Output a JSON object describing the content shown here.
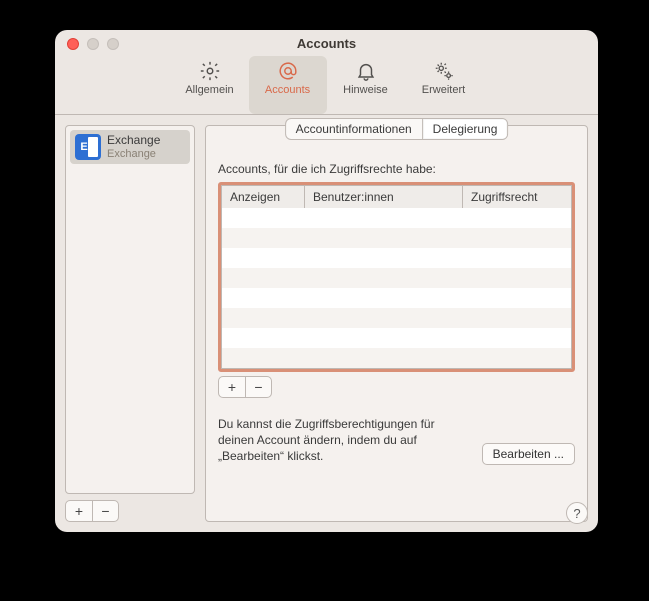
{
  "window": {
    "title": "Accounts"
  },
  "toolbar": {
    "general": "Allgemein",
    "accounts": "Accounts",
    "notifications": "Hinweise",
    "advanced": "Erweitert"
  },
  "sidebar": {
    "accounts": [
      {
        "name": "Exchange",
        "type": "Exchange"
      }
    ]
  },
  "panel": {
    "tabs": [
      "Accountinformationen",
      "Delegierung"
    ],
    "section_label": "Accounts, für die ich Zugriffsrechte habe:",
    "columns": [
      "Anzeigen",
      "Benutzer:innen",
      "Zugriffsrecht"
    ],
    "hint": "Du kannst die Zugriffsberechtigungen für deinen Account ändern, indem du auf „Bearbeiten“ klickst.",
    "edit_button": "Bearbeiten ..."
  },
  "buttons": {
    "plus": "+",
    "minus": "−",
    "help": "?"
  }
}
